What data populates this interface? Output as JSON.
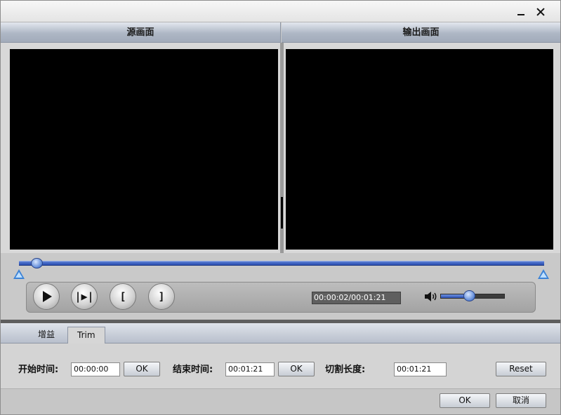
{
  "window": {
    "minimize_icon": "minimize-icon",
    "close_icon": "close-icon"
  },
  "preview": {
    "source_title": "源画面",
    "output_title": "输出画面"
  },
  "player": {
    "play_icon": "play-icon",
    "step_label": "|▶|",
    "mark_in_label": "[",
    "mark_out_label": "]",
    "time_display": "00:00:02/00:01:21",
    "volume_icon": "speaker-icon",
    "volume_level": 0.45,
    "timeline_position": 0.02
  },
  "tabs": [
    {
      "label": "增益"
    },
    {
      "label": "Trim"
    }
  ],
  "trim": {
    "start_label": "开始时间:",
    "start_value": "00:00:00",
    "start_ok": "OK",
    "end_label": "结束时间:",
    "end_value": "00:01:21",
    "end_ok": "OK",
    "length_label": "切割长度:",
    "length_value": "00:01:21",
    "reset_label": "Reset"
  },
  "footer": {
    "ok_label": "OK",
    "cancel_label": "取消"
  },
  "colors": {
    "accent_blue": "#3b82d6",
    "screen_black": "#000000"
  }
}
